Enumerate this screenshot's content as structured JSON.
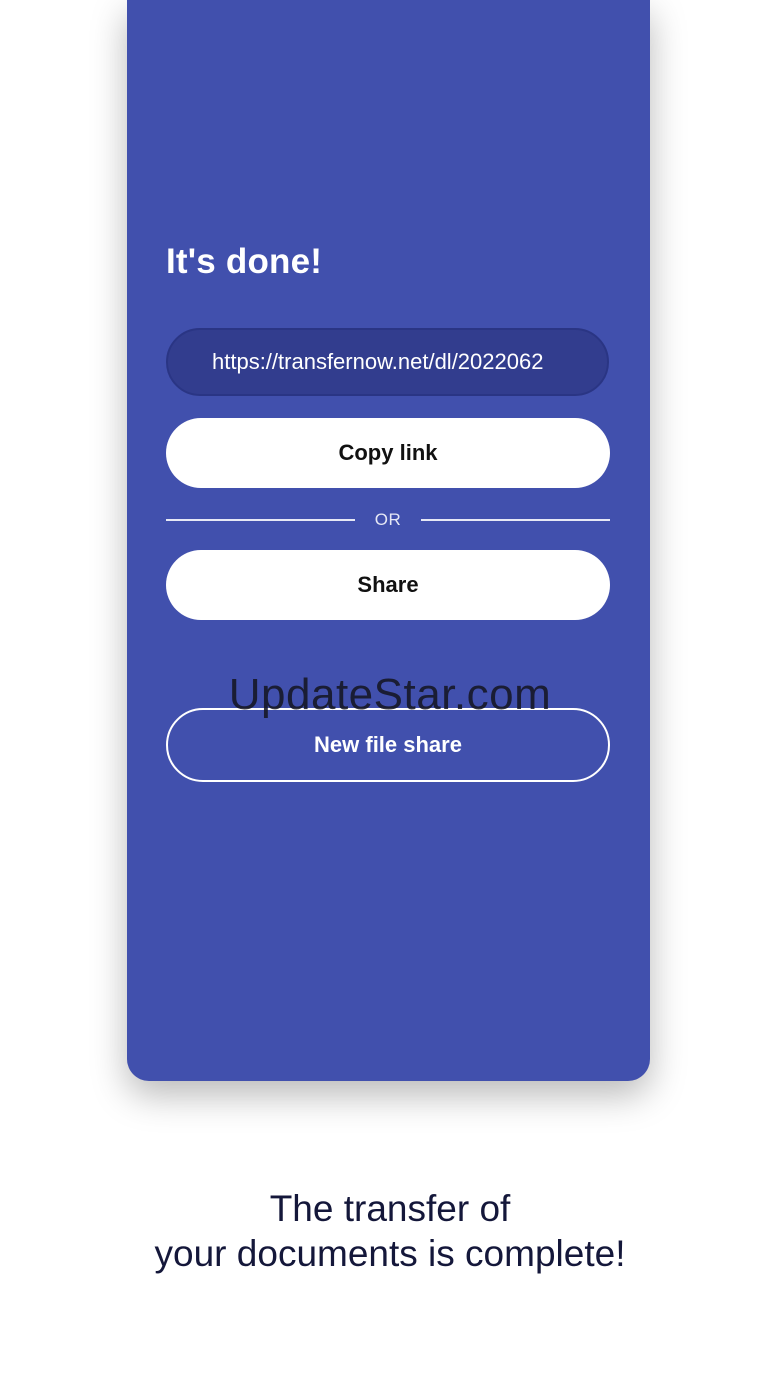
{
  "card": {
    "title": "It's done!",
    "link_value": "https://transfernow.net/dl/2022062",
    "copy_button_label": "Copy link",
    "divider_label": "OR",
    "share_button_label": "Share",
    "new_share_button_label": "New file share"
  },
  "watermark": "UpdateStar.com",
  "caption": {
    "line1": "The transfer of",
    "line2": "your documents is complete!"
  },
  "colors": {
    "card_background": "#4150ad",
    "link_field_background": "#323d8e",
    "caption_text": "#14173a"
  }
}
